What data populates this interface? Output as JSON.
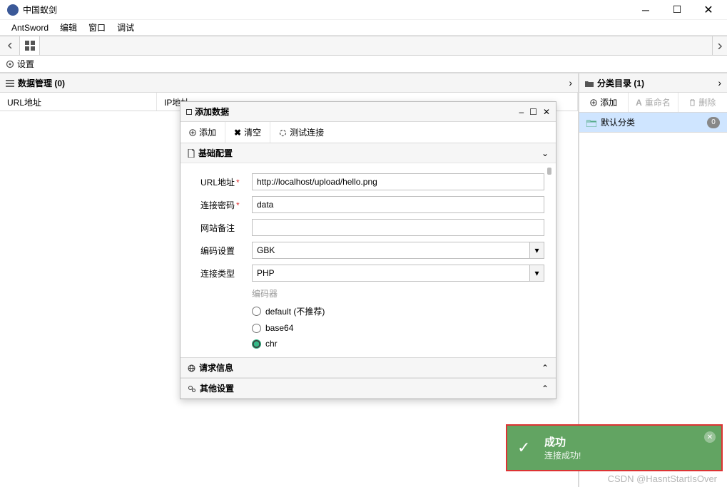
{
  "window": {
    "title": "中国蚁剑"
  },
  "menu": {
    "appname": "AntSword",
    "edit": "编辑",
    "window": "窗口",
    "debug": "调试"
  },
  "settings_label": "设置",
  "datapanel": {
    "title": "数据管理 (0)",
    "columns": {
      "url": "URL地址",
      "ip": "IP地址"
    }
  },
  "catpanel": {
    "title": "分类目录 (1)",
    "toolbar": {
      "add": "添加",
      "rename": "重命名",
      "delete": "删除"
    },
    "items": [
      {
        "label": "默认分类",
        "count": "0"
      }
    ]
  },
  "dialog": {
    "title": "添加数据",
    "toolbar": {
      "add": "添加",
      "clear": "清空",
      "test": "测试连接"
    },
    "sections": {
      "basic": "基础配置",
      "request": "请求信息",
      "other": "其他设置"
    },
    "form": {
      "url_label": "URL地址",
      "url_value": "http://localhost/upload/hello.png",
      "pwd_label": "连接密码",
      "pwd_value": "data",
      "note_label": "网站备注",
      "note_value": "",
      "enc_label": "编码设置",
      "enc_value": "GBK",
      "type_label": "连接类型",
      "type_value": "PHP",
      "encoder_label": "编码器",
      "encoders": [
        {
          "label": "default (不推荐)",
          "selected": false
        },
        {
          "label": "base64",
          "selected": false
        },
        {
          "label": "chr",
          "selected": true
        }
      ]
    }
  },
  "toast": {
    "title": "成功",
    "message": "连接成功!"
  },
  "watermark": "CSDN @HasntStartIsOver"
}
